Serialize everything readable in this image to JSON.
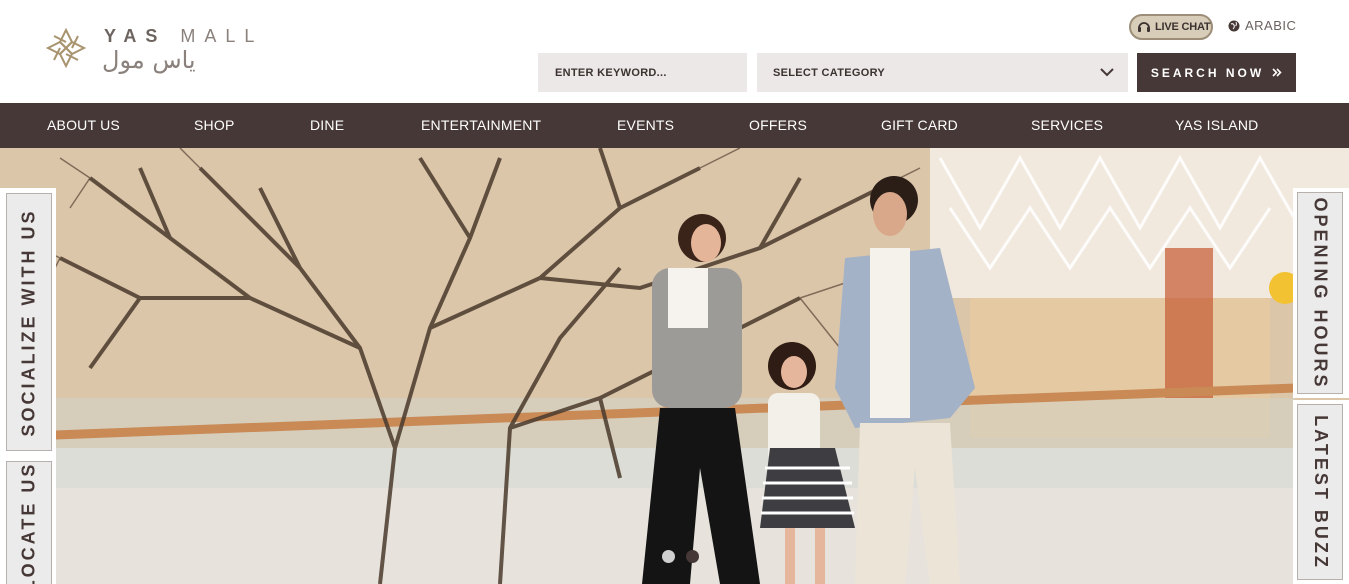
{
  "brand": {
    "name_en_bold": "YAS",
    "name_en_light": "MALL",
    "name_ar": "ياس مول",
    "accent": "#463836",
    "gold": "#a8946f"
  },
  "header": {
    "live_chat": "LIVE CHAT",
    "language": "ARABIC",
    "search": {
      "placeholder": "ENTER KEYWORD...",
      "category": "SELECT CATEGORY",
      "button": "SEARCH NOW"
    }
  },
  "nav": {
    "items": [
      {
        "label": "ABOUT US"
      },
      {
        "label": "SHOP"
      },
      {
        "label": "DINE"
      },
      {
        "label": "ENTERTAINMENT"
      },
      {
        "label": "EVENTS"
      },
      {
        "label": "OFFERS"
      },
      {
        "label": "GIFT CARD"
      },
      {
        "label": "SERVICES"
      },
      {
        "label": "YAS ISLAND"
      }
    ]
  },
  "side_tabs": {
    "socialize": "SOCIALIZE WITH US",
    "locate": "LOCATE US",
    "opening_hours": "OPENING HOURS",
    "latest_buzz": "LATEST BUZZ"
  },
  "hero": {
    "slides_count": 2,
    "active_slide": 2
  }
}
